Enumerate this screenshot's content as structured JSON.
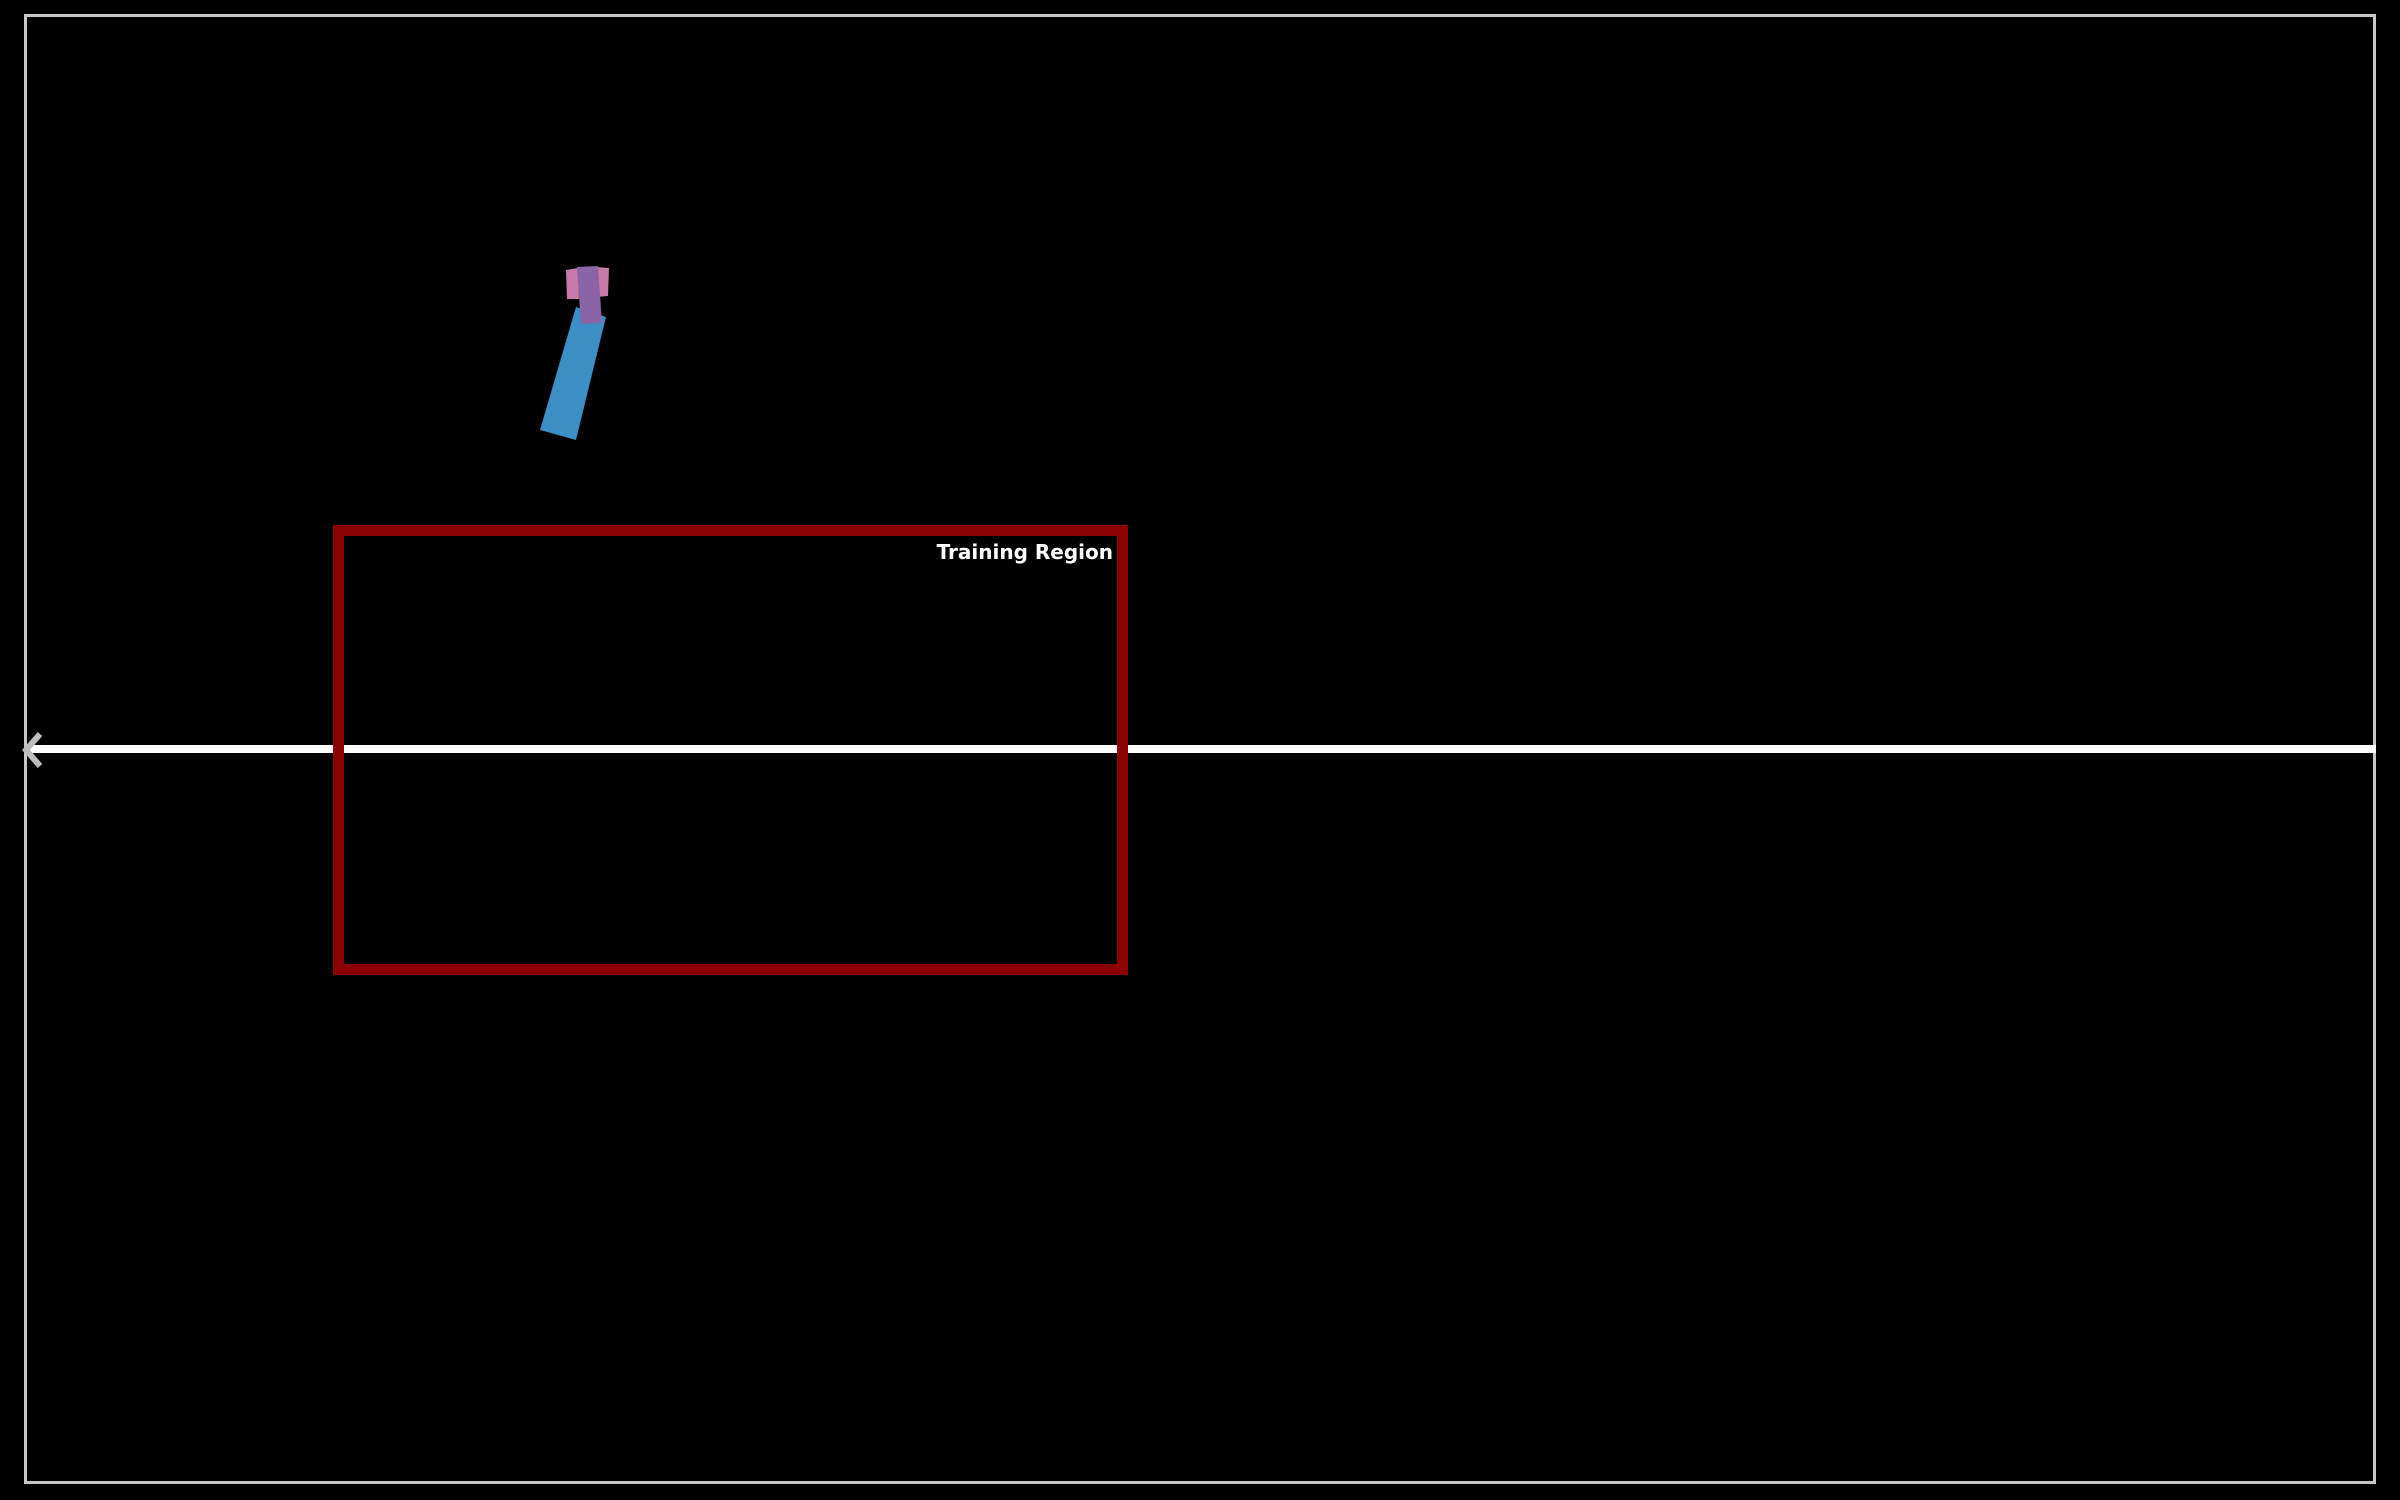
{
  "scene": {
    "background_color": "#000000",
    "border_color": "#c8c8c8",
    "ground_color": "#ffffff"
  },
  "training_region": {
    "label": "Training Region",
    "color": "#8b0000"
  },
  "agent": {
    "leg_color": "#3a8fc4",
    "torso_color": "#8a64a6",
    "arm_color": "#c97aa9"
  },
  "offscreen_indicator": {
    "icon": "chevron-left-icon",
    "color": "#bdbdbd"
  }
}
